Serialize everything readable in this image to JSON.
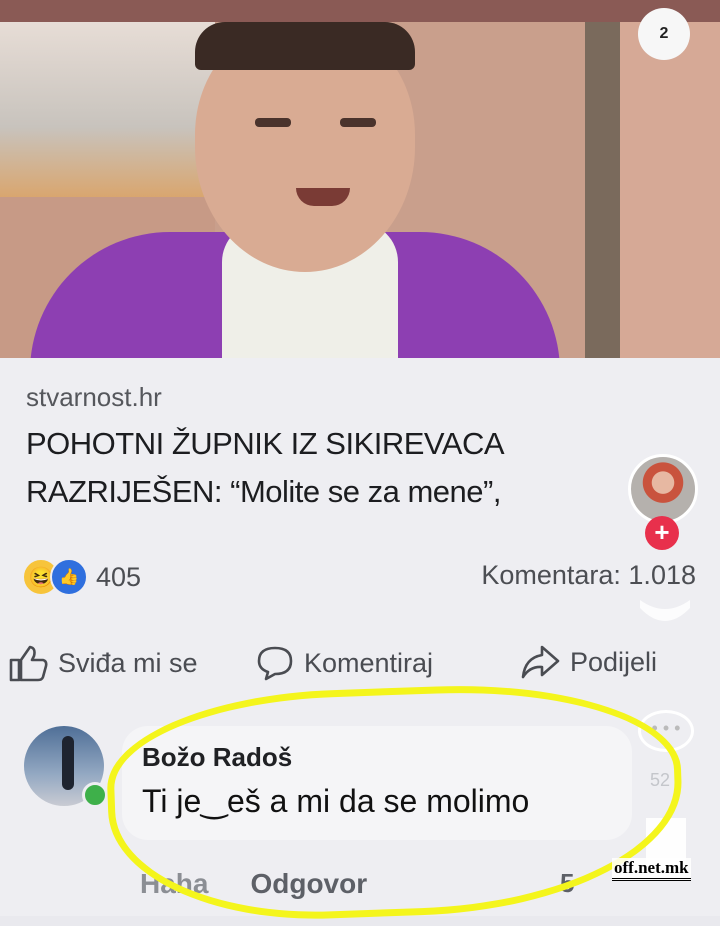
{
  "photo": {
    "badge": "2"
  },
  "post": {
    "domain": "stvarnost.hr",
    "headline": "POHOTNI ŽUPNIK IZ SIKIREVACA RAZRIJEŠEN: “Molite se za mene”,",
    "reaction_count": "405",
    "comments_count": "Komentara: 1.018",
    "colors": {
      "like_blue": "#2f6fde",
      "haha_yellow": "#f7c43b",
      "plus_red": "#e8304c",
      "highlight_yellow": "#f4f51c"
    }
  },
  "actions": {
    "like": "Sviđa mi se",
    "comment": "Komentiraj",
    "share": "Podijeli"
  },
  "comment": {
    "author": "Božo Radoš",
    "text": "Ti je‿eš a mi da se molimo",
    "haha": "Haha",
    "reply": "Odgovor",
    "count": "5",
    "side_count": "52"
  },
  "watermark": "off.net.mk"
}
